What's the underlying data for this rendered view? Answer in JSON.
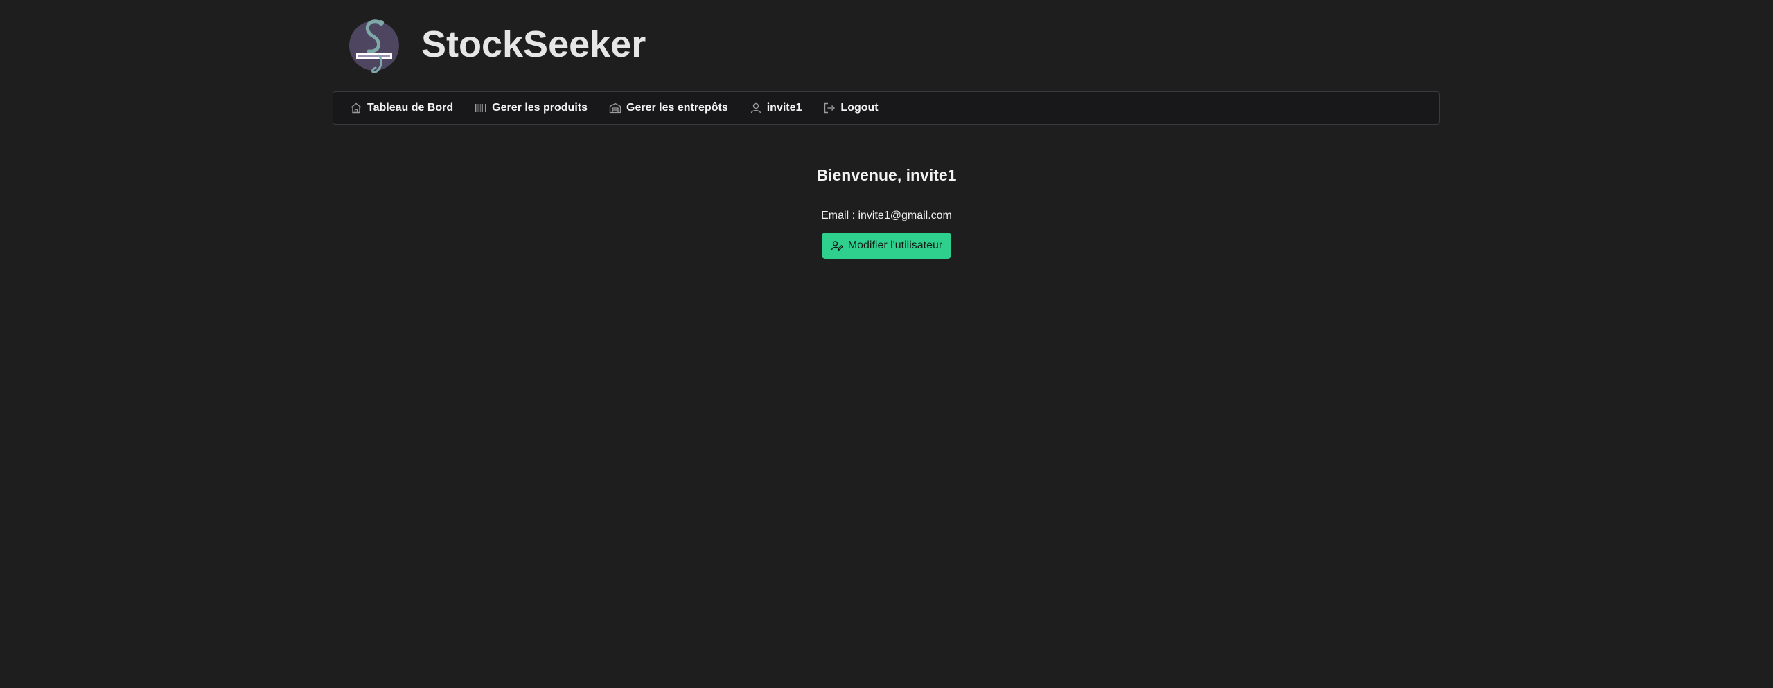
{
  "app": {
    "title": "StockSeeker",
    "logo_icon": "stockseeker-logo"
  },
  "nav": {
    "items": [
      {
        "label": "Tableau de Bord",
        "icon": "home-icon"
      },
      {
        "label": "Gerer les produits",
        "icon": "barcode-icon"
      },
      {
        "label": "Gerer les entrepôts",
        "icon": "warehouse-icon"
      },
      {
        "label": "invite1",
        "icon": "user-icon"
      },
      {
        "label": "Logout",
        "icon": "logout-icon"
      }
    ]
  },
  "main": {
    "welcome": "Bienvenue, invite1",
    "email_line": "Email : invite1@gmail.com",
    "edit_button_label": "Modifier l'utilisateur"
  },
  "colors": {
    "background": "#1e1e1e",
    "navbar_bg": "#18181a",
    "accent": "#2fcf8e"
  }
}
